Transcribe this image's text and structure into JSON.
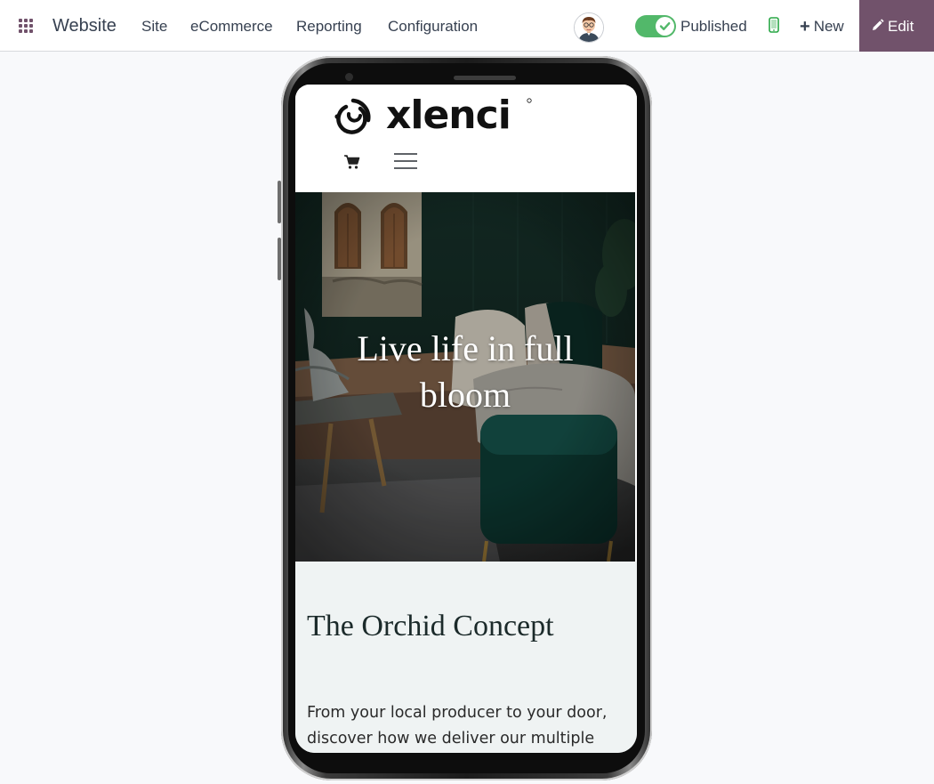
{
  "topbar": {
    "brand": "Website",
    "menu": [
      {
        "label": "Site"
      },
      {
        "label": "eCommerce"
      },
      {
        "label": "Reporting"
      },
      {
        "label": "Configuration"
      }
    ],
    "published_label": "Published",
    "published": true,
    "new_label": "New",
    "edit_label": "Edit",
    "accent_color": "#71526b",
    "toggle_color": "#28a745"
  },
  "site": {
    "logo_text": "xlenci",
    "hero_title": "Live life in full bloom",
    "section_title": "The Orchid Concept",
    "section_text": "From your local producer to your door, discover how we deliver our multiple"
  }
}
